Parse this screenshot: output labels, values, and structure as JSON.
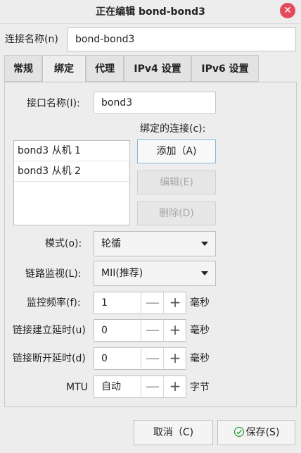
{
  "window": {
    "title": "正在编辑 bond-bond3",
    "close_glyph": "✕"
  },
  "connection_name": {
    "label": "连接名称(n)",
    "value": "bond-bond3"
  },
  "tabs": [
    {
      "label": "常规"
    },
    {
      "label": "绑定"
    },
    {
      "label": "代理"
    },
    {
      "label": "IPv4 设置"
    },
    {
      "label": "IPv6 设置"
    }
  ],
  "active_tab": "绑定",
  "bond": {
    "interface_label": "接口名称(I):",
    "interface_value": "bond3",
    "connections_label": "绑定的连接(c):",
    "connections": [
      "bond3 从机 1",
      "bond3 从机 2"
    ],
    "add_label": "添加（A)",
    "edit_label": "编辑(E)",
    "delete_label": "删除(D)",
    "mode_label": "模式(o):",
    "mode_value": "轮循",
    "monitor_label": "链路监视(L):",
    "monitor_value": "MII(推荐)",
    "frequency_label": "监控频率(f):",
    "frequency_value": "1",
    "frequency_unit": "毫秒",
    "updelay_label": "链接建立延时(u)",
    "updelay_value": "0",
    "updelay_unit": "毫秒",
    "downdelay_label": "链接断开延时(d)",
    "downdelay_value": "0",
    "downdelay_unit": "毫秒",
    "mtu_label": "MTU",
    "mtu_value": "自动",
    "mtu_unit": "字节",
    "minus_glyph": "—",
    "plus_glyph": "+"
  },
  "footer": {
    "cancel_label": "取消（C)",
    "save_label": "保存(S)"
  },
  "colors": {
    "close_button": "#e24b5c",
    "focus_border": "#7fbce0",
    "save_check": "#2e9b3a"
  }
}
